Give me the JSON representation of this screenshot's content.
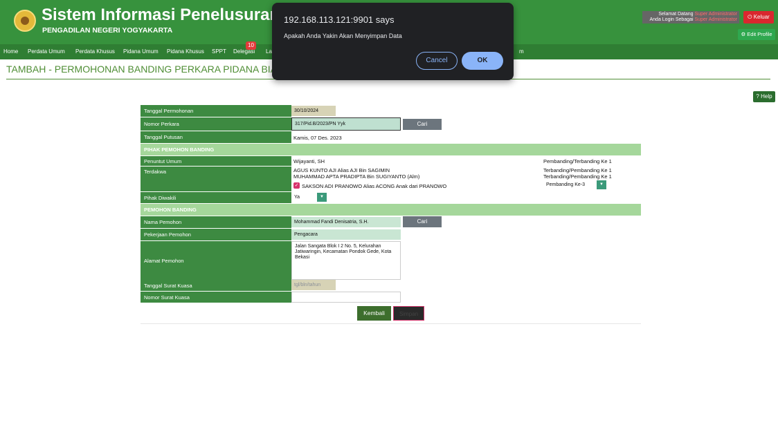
{
  "header": {
    "title": "Sistem Informasi Penelusuran Perka",
    "subtitle": "PENGADILAN NEGERI YOGYAKARTA",
    "welcome_line1": "Selamat Datang",
    "welcome_line2": "Anda Login Sebagai",
    "welcome_user": "Super Administrator",
    "logout": "Keluar",
    "edit_profile": "Edit Profile"
  },
  "nav": {
    "items": [
      "Home",
      "Perdata Umum",
      "Perdata Khusus",
      "Pidana Umum",
      "Pidana Khusus",
      "SPPT",
      "Delegasi",
      "La",
      "m"
    ],
    "badge": "10",
    "help": "Help"
  },
  "page_title": "TAMBAH - PERMOHONAN BANDING PERKARA PIDANA BIASA (e",
  "form": {
    "tanggal_permohonan_label": "Tanggal Permohonan",
    "tanggal_permohonan": "30/10/2024",
    "nomor_perkara_label": "Nomor Perkara",
    "nomor_perkara": "317/Pid.B/2023/PN Yyk",
    "cari": "Cari",
    "tanggal_putusan_label": "Tanggal Putusan",
    "tanggal_putusan": "Kamis, 07 Des. 2023",
    "section_pihak": "PIHAK PEMOHON BANDING",
    "penuntut_label": "Penuntut Umum",
    "penuntut": "Wijayanti, SH",
    "penuntut_role": "Pembanding/Terbanding Ke 1",
    "terdakwa_label": "Terdakwa",
    "terdakwa": [
      {
        "name": "AGUS KUNTO AJI Alias AJI Bin SAGIMIN",
        "role": "Terbanding/Pembanding Ke 1"
      },
      {
        "name": "MUHAMMAD APTA PRADIPTA Bin SUGIYANTO (Alm)",
        "role": "Terbanding/Pembanding Ke 1"
      },
      {
        "name": "SAKSON ADI PRANOWO Alias ACONG Anak dari PRANOWO",
        "role": "Pembanding Ke-3"
      }
    ],
    "diwakili_label": "Pihak Diwakili",
    "diwakili": "Ya",
    "section_pemohon": "PEMOHON BANDING",
    "nama_label": "Nama Pemohon",
    "nama": "Mohammad Fandi Denisatria, S.H.",
    "cari2": "Cari",
    "pekerjaan_label": "Pekerjaan Pemohon",
    "pekerjaan": "Pengacara",
    "alamat_label": "Alamat Pemohon",
    "alamat": "Jalan Sangata Blok I 2 No. 5, Kelurahan Jatiwaringin, Kecamatan Pondok Gede, Kota Bekasi",
    "tgl_kuasa_label": "Tanggal Surat Kuasa",
    "tgl_kuasa_placeholder": "tgl/bln/tahun",
    "no_kuasa_label": "Nomor Surat Kuasa",
    "kembali": "Kembali",
    "simpan": "Simpan"
  },
  "dialog": {
    "title": "192.168.113.121:9901 says",
    "message": "Apakah Anda Yakin Akan Menyimpan Data",
    "cancel": "Cancel",
    "ok": "OK"
  }
}
